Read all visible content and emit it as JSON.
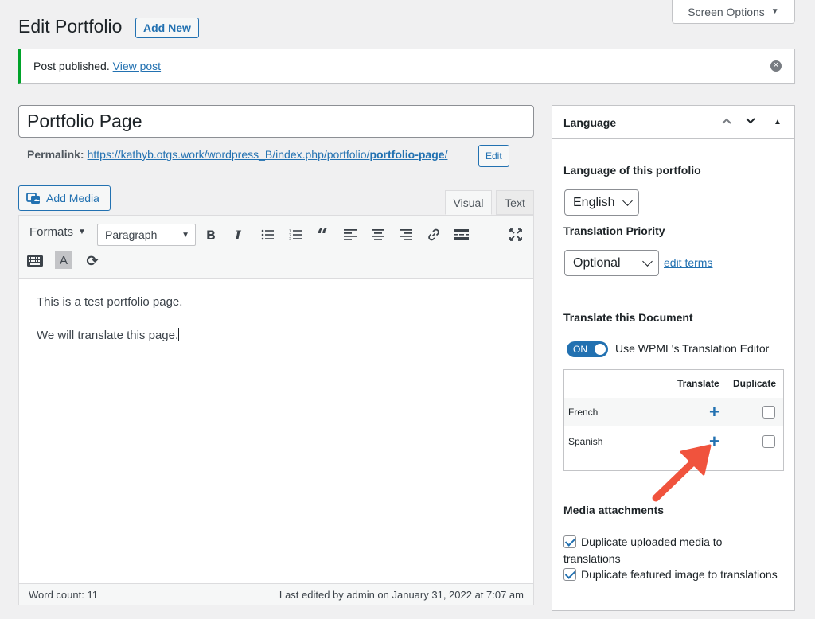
{
  "header": {
    "screen_options": "Screen Options",
    "title": "Edit Portfolio",
    "add_new": "Add New"
  },
  "notice": {
    "text": "Post published.",
    "link": "View post"
  },
  "post": {
    "title": "Portfolio Page",
    "permalink_label": "Permalink:",
    "permalink_base": "https://kathyb.otgs.work/wordpress_B/index.php/portfolio/",
    "permalink_slug": "portfolio-page",
    "permalink_end": "/",
    "edit_button": "Edit"
  },
  "editor": {
    "add_media": "Add Media",
    "tab_visual": "Visual",
    "tab_text": "Text",
    "formats": "Formats",
    "paragraph": "Paragraph",
    "content": [
      "This is a test portfolio page.",
      "We will translate this page."
    ],
    "word_count": "Word count: 11",
    "last_edited": "Last edited by admin on January 31, 2022 at 7:07 am",
    "toolbar_icons": [
      "bold-icon",
      "italic-icon",
      "bullet-list-icon",
      "numbered-list-icon",
      "blockquote-icon",
      "align-left-icon",
      "align-center-icon",
      "align-right-icon",
      "link-icon",
      "read-more-icon",
      "fullscreen-icon",
      "toolbar-toggle-icon",
      "text-color-icon",
      "sync-icon"
    ]
  },
  "language_box": {
    "title": "Language",
    "language_label": "Language of this portfolio",
    "language_value": "English",
    "priority_label": "Translation Priority",
    "priority_value": "Optional",
    "edit_terms": "edit terms",
    "translate_label": "Translate this Document",
    "toggle_state": "ON",
    "toggle_label": "Use WPML's Translation Editor",
    "col_translate": "Translate",
    "col_duplicate": "Duplicate",
    "languages": [
      "French",
      "Spanish"
    ],
    "media_label": "Media attachments",
    "dup_media": "Duplicate uploaded media to translations",
    "dup_featured": "Duplicate featured image to translations"
  },
  "colors": {
    "accent": "#2271b1",
    "success": "#00a32a",
    "annotation_arrow": "#f0533d"
  }
}
